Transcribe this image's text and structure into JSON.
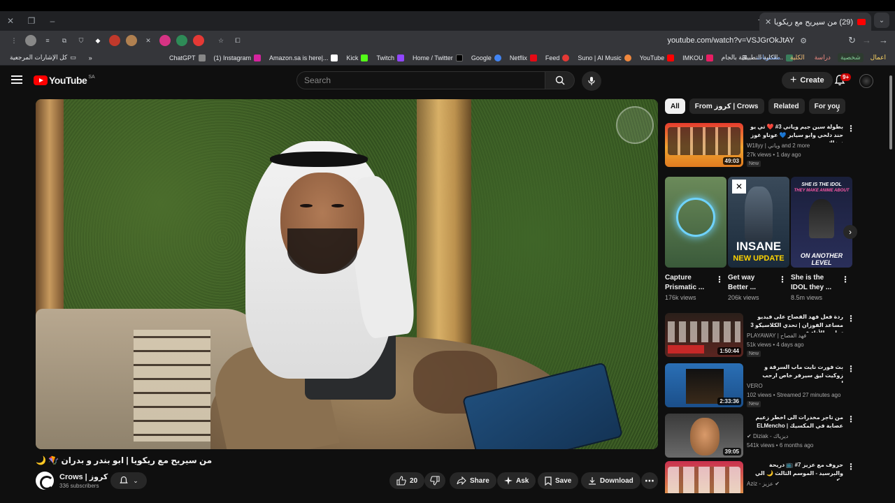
{
  "browser": {
    "tab_title": "(29) من سيريح مع ريكويا | ابو بند...",
    "close": "✕",
    "new_tab": "+",
    "url": "youtube.com/watch?v=VSJGrOkJtAY",
    "bookmarks_left": "كل الإشارات المرجعية",
    "bookmarks": [
      "ChatGPT",
      "(1) Instagram",
      "Amazon.sa is here|...",
      "Kick",
      "Twitch",
      "Home / Twitter",
      "Google",
      "Netflix",
      "Feed",
      "Suno | AI Music",
      "YouTube",
      "IMKOU",
      "الكلية التطبيقية بالجام..."
    ],
    "folders": [
      "مشتريات",
      "الكلية",
      "دراسة",
      "شخصية",
      "اعمال"
    ]
  },
  "header": {
    "logo": "YouTube",
    "country": "SA",
    "search_placeholder": "Search",
    "create_label": "Create",
    "notif_count": "9+"
  },
  "video": {
    "title": "من سيريح مع ريكويا | ابو بندر و بدران 🪁 🌙",
    "channel_name": "Crows | كروز",
    "subscribers": "336 subscribers",
    "likes": "20",
    "share": "Share",
    "ask": "Ask",
    "save": "Save",
    "download": "Download"
  },
  "chips": [
    "All",
    "From كروز | Crows",
    "Related",
    "For you"
  ],
  "recommendations": [
    {
      "title": "بطولة سين جيم وياني 3# ❤️ تي يو حند دلحي وابو سياير 💙 عوناو غوز نرزاك",
      "channel": "W1llyy | وياني and 2 more",
      "meta": "27k views • 1 day ago",
      "duration": "49:03",
      "badge": "New"
    },
    {
      "title": "ردة فعل فهد الفصاح على فيديو مساعد الفوزان | تحدي الكلاسيكو 3 تجارب الأداء في ...",
      "channel": "PLAYAWAY | فهد الفصاح",
      "meta": "51k views • 4 days ago",
      "duration": "1:50:44",
      "badge": "New"
    },
    {
      "title": "بث فورت نايت ماب السرقة و زوكيت ليق سيرفر خاص ارحب ارحب",
      "channel": "VERO",
      "meta": "102 views • Streamed 27 minutes ago",
      "duration": "2:33:36",
      "badge": "New"
    },
    {
      "title": "من تاجر مخدرات الى اخطر زعيم عصابة في المكسيك | ELMencho",
      "channel": "Diziak - ديزياك",
      "meta": "541k views • 6 months ago",
      "duration": "39:05",
      "badge": ""
    },
    {
      "title": "حروف مع عزيز 7# 📺 دريحة والبرسيد - الموسم الثالث 🌙 الي وكيجب",
      "channel": "Aziz - عزيز",
      "meta": "",
      "duration": "",
      "badge": ""
    }
  ],
  "shorts": [
    {
      "title": "Capture Prismatic ...",
      "views": "176k views"
    },
    {
      "title": "Get way Better ...",
      "views": "206k views"
    },
    {
      "title": "She is the IDOL they ...",
      "views": "8.5m views"
    }
  ],
  "shorts_overlay": {
    "s2_big": "INSANE",
    "s2_big2": "NEW UPDATE",
    "s3_top": "SHE IS THE IDOL",
    "s3_top2": "THEY MAKE ANIME ABOUT",
    "s3_bottom": "ON ANOTHER LEVEL"
  }
}
